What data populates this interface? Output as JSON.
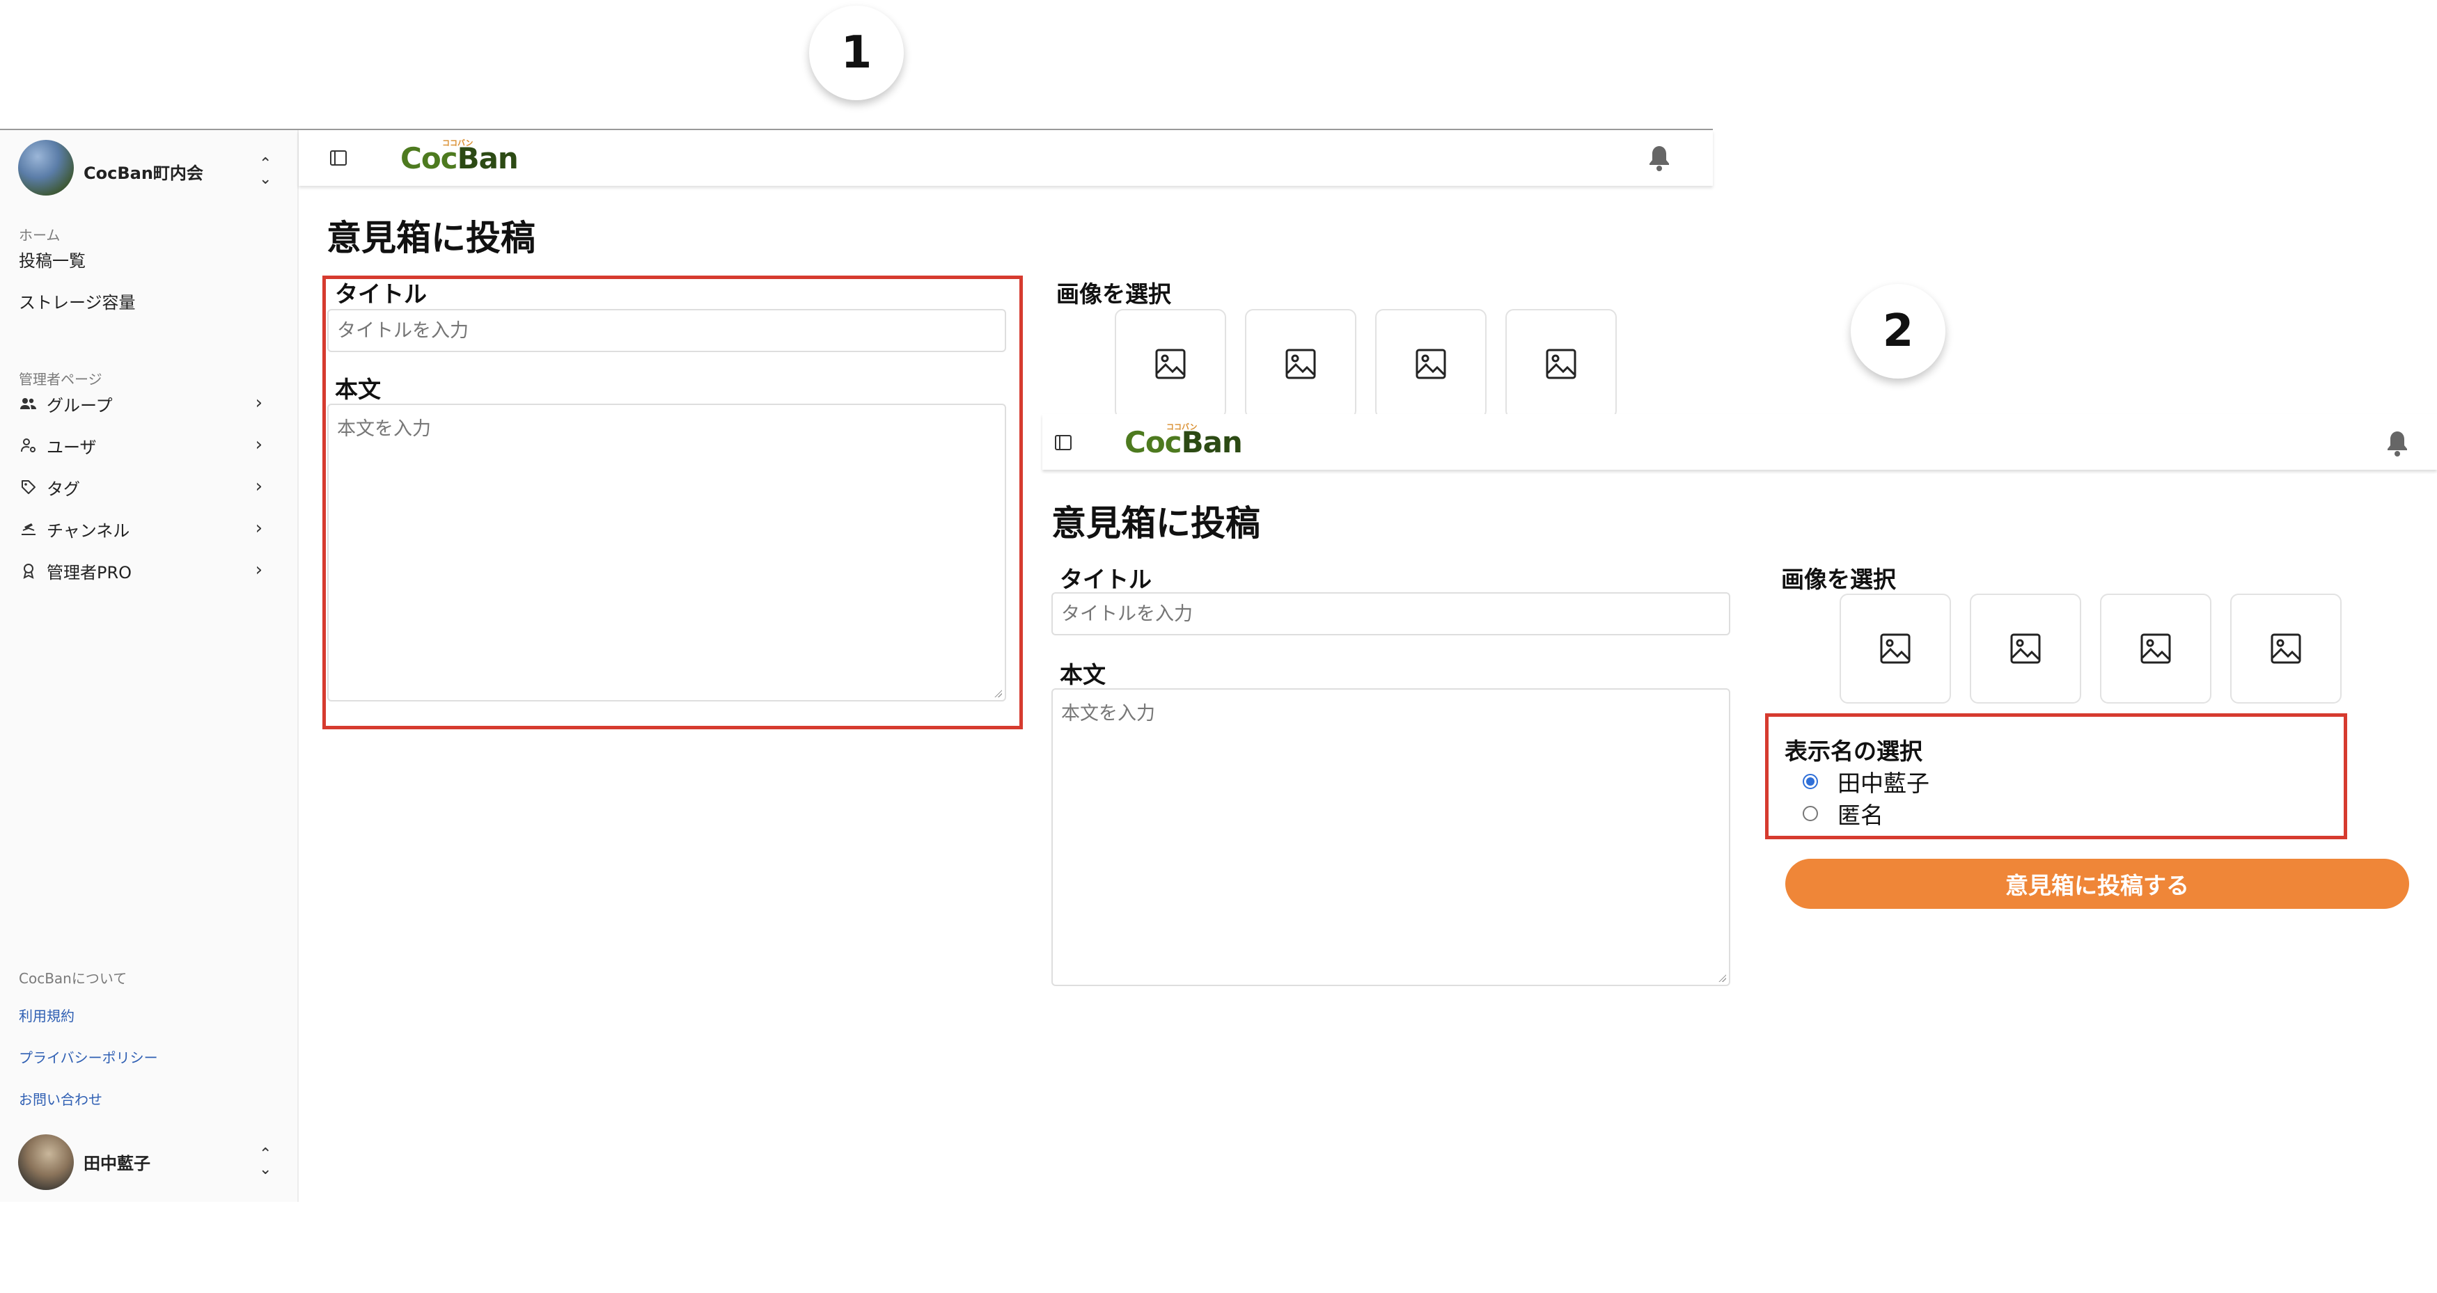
{
  "steps": [
    "1",
    "2"
  ],
  "sidebar": {
    "org_name": "CocBan町内会",
    "sections": {
      "home": "ホーム",
      "admin": "管理者ページ",
      "about": "CocBanについて"
    },
    "main_items": [
      {
        "label": "投稿一覧"
      },
      {
        "label": "ストレージ容量"
      }
    ],
    "admin_items": [
      {
        "label": "グループ",
        "icon": "users-icon"
      },
      {
        "label": "ユーザ",
        "icon": "user-settings-icon"
      },
      {
        "label": "タグ",
        "icon": "tag-icon"
      },
      {
        "label": "チャンネル",
        "icon": "channel-icon"
      },
      {
        "label": "管理者PRO",
        "icon": "badge-icon"
      }
    ],
    "footer_links": [
      {
        "label": "利用規約"
      },
      {
        "label": "プライバシーポリシー"
      },
      {
        "label": "お問い合わせ"
      }
    ],
    "user_name": "田中藍子"
  },
  "header": {
    "logo_text": "CocBan",
    "logo_ruby": "ココバン"
  },
  "form": {
    "page_title": "意見箱に投稿",
    "title_label": "タイトル",
    "title_placeholder": "タイトルを入力",
    "body_label": "本文",
    "body_placeholder": "本文を入力",
    "image_label": "画像を選択",
    "image_slots": 4,
    "display_name_label": "表示名の選択",
    "display_name_options": [
      {
        "label": "田中藍子",
        "selected": true
      },
      {
        "label": "匿名",
        "selected": false
      }
    ],
    "submit_label": "意見箱に投稿する"
  },
  "colors": {
    "accent_orange": "#ef8638",
    "highlight_red": "#d63b2f",
    "logo_green": "#4d7a1f",
    "radio_blue": "#2f6fd8",
    "link_blue": "#2f5fb3"
  }
}
